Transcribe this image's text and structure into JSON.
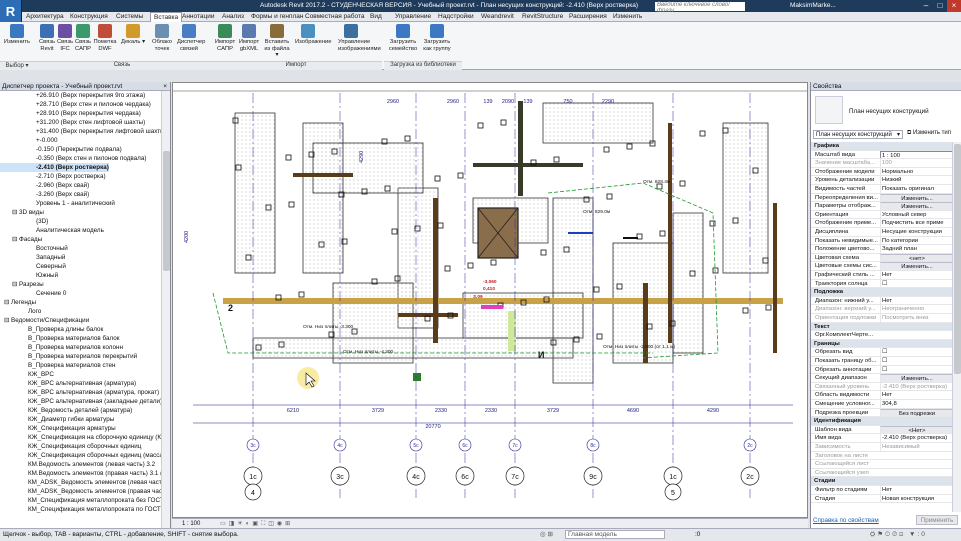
{
  "app": {
    "title": "Autodesk Revit 2017.2 - СТУДЕНЧЕСКАЯ ВЕРСИЯ -   Учебный проект.rvt - План несущих конструкций: -2.410 (Верх ростверка)",
    "logo": "R",
    "search_placeholder": "Введите ключевое слово/фразу",
    "user": "MaksimMarke..."
  },
  "tabs": [
    "Архитектура",
    "Конструкция",
    "Системы",
    "Вставка",
    "Аннотации",
    "Анализ",
    "Формы и генплан",
    "Совместная работа",
    "Вид",
    "Управление",
    "Надстройки",
    "Weandrevit",
    "RevitStructure",
    "Расширения",
    "Изменить"
  ],
  "active_tab": "Вставка",
  "ribbon": {
    "modify": "Изменить",
    "select": "Выбор ▾",
    "link_buttons": [
      "Связь Revit",
      "Связь IFC",
      "Связь САПР",
      "Пометка DWF",
      "Декаль ▾",
      "Облако точек",
      "Диспетчер связей"
    ],
    "link_group": "Связь",
    "import_buttons": [
      "Импорт САПР",
      "Импорт gbXML",
      "Вставить из файла ▾",
      "Изображение",
      "Управление изображениями"
    ],
    "import_group": "Импорт",
    "library_buttons": [
      "Загрузить семейство",
      "Загрузить как группу"
    ],
    "library_group": "Загрузка из библиотеки"
  },
  "project_browser": {
    "title": "Диспетчер проекта - Учебный проект.rvt",
    "items": [
      {
        "t": "+26.910 (Верх перекрытия 9го этажа)",
        "l": 4
      },
      {
        "t": "+28.710 (Верх стен и пилонов чердака)",
        "l": 4
      },
      {
        "t": "+28.910 (Верх перекрытия чердака)",
        "l": 4
      },
      {
        "t": "+31.200 (Верх стен лифтовой шахты)",
        "l": 4
      },
      {
        "t": "+31.400 (Верх перекрытия лифтовой шахты)",
        "l": 4
      },
      {
        "t": "+-0.000",
        "l": 4
      },
      {
        "t": "-0.150 (Перекрытие подвала)",
        "l": 4
      },
      {
        "t": "-0.350 (Верх стен и пилонов подвала)",
        "l": 4
      },
      {
        "t": "-2.410 (Верх ростверка)",
        "l": 4,
        "sel": true,
        "b": true
      },
      {
        "t": "-2.710 (Верх ростверка)",
        "l": 4
      },
      {
        "t": "-2.960 (Верх свай)",
        "l": 4
      },
      {
        "t": "-3.260 (Верх свай)",
        "l": 4
      },
      {
        "t": "Уровень 1 - аналитический",
        "l": 4
      },
      {
        "t": "⊟ 3D виды",
        "l": 1
      },
      {
        "t": "{3D}",
        "l": 4
      },
      {
        "t": "Аналитическая модель",
        "l": 4
      },
      {
        "t": "⊟ Фасады",
        "l": 1
      },
      {
        "t": "Восточный",
        "l": 4
      },
      {
        "t": "Западный",
        "l": 4
      },
      {
        "t": "Северный",
        "l": 4
      },
      {
        "t": "Южный",
        "l": 4
      },
      {
        "t": "⊟ Разрезы",
        "l": 1
      },
      {
        "t": "Сечение 0",
        "l": 4
      },
      {
        "t": "⊟ Легенды",
        "l": 0
      },
      {
        "t": "Лого",
        "l": 3
      },
      {
        "t": "⊟ Ведомости/Спецификации",
        "l": 0
      },
      {
        "t": "В_Проверка длины балок",
        "l": 3
      },
      {
        "t": "В_Проверка материалов балок",
        "l": 3
      },
      {
        "t": "В_Проверка материалов колонн",
        "l": 3
      },
      {
        "t": "В_Проверка материалов перекрытий",
        "l": 3
      },
      {
        "t": "В_Проверка материалов стен",
        "l": 3
      },
      {
        "t": "КЖ_ВРС",
        "l": 3
      },
      {
        "t": "КЖ_ВРС альтернативная (арматура)",
        "l": 3
      },
      {
        "t": "КЖ_ВРС альтернативная (арматура, прокат)",
        "l": 3
      },
      {
        "t": "КЖ_ВРС альтернативная (закладные детали)",
        "l": 3
      },
      {
        "t": "КЖ_Ведомость деталей (арматура)",
        "l": 3
      },
      {
        "t": "КЖ_Диаметр гибки арматуры",
        "l": 3
      },
      {
        "t": "КЖ_Спецификация арматуры",
        "l": 3
      },
      {
        "t": "КЖ_Спецификация на сборочную единицу (КЖИ",
        "l": 3
      },
      {
        "t": "КЖ_Спецификация сборочных единиц",
        "l": 3
      },
      {
        "t": "КЖ_Спецификация сборочных единиц (масса ед",
        "l": 3
      },
      {
        "t": "КМ.Ведомость элементов (левая часть) 3.2",
        "l": 3
      },
      {
        "t": "КМ.Ведомость элементов (правая часть) 3.1 (пра",
        "l": 3
      },
      {
        "t": "КМ_ADSK_Ведомость элементов (левая часть)",
        "l": 3
      },
      {
        "t": "КМ_ADSK_Ведомость элементов (правая часть)",
        "l": 3
      },
      {
        "t": "КМ_Спецификация металлопроката без ГОСТ",
        "l": 3
      },
      {
        "t": "КМ_Спецификация металлопроката по ГОСТ",
        "l": 3
      }
    ]
  },
  "drawing": {
    "dims_bottom": [
      "6210",
      "3729",
      "2330",
      "2330",
      "3729",
      "4690",
      "4290"
    ],
    "total": "20770",
    "dims_top": [
      "2960",
      "2960",
      "139",
      "2090",
      "139",
      "750",
      "2290"
    ],
    "grid_bubbles_top": [
      "3с",
      "4с",
      "5с",
      "6с",
      "7с",
      "8с",
      "2с"
    ],
    "grid_bubbles_bottom": [
      "1с",
      "3с",
      "4с",
      "6с",
      "7с",
      "9с",
      "1с",
      "2с"
    ],
    "axis_numbers": [
      "4",
      "5"
    ],
    "side_dims": [
      "4200",
      "4290"
    ],
    "level_labels": [
      "Отм. Низ плиты -4.300",
      "Отм. Низ плиты -3.300",
      "Отм. Низ плиты -2.900 (от 1.1 м)",
      "Отм. 828.4м",
      "Отм. 829.0м"
    ],
    "marks": [
      "2",
      "И",
      "З.09",
      "-3,060",
      "0,410"
    ],
    "scale": "1 : 100"
  },
  "properties": {
    "title": "Свойства",
    "type_name": "План несущих конструкций",
    "type_selector": "План несущих конструкций",
    "edit_type": "Изменить тип",
    "rows": [
      {
        "sec": "Графика"
      },
      {
        "k": "Масштаб вида",
        "v": "1 : 100",
        "input": true
      },
      {
        "k": "Значение масштаба...",
        "v": "100",
        "dim": true
      },
      {
        "k": "Отображение модели",
        "v": "Нормально"
      },
      {
        "k": "Уровень детализации",
        "v": "Низкий"
      },
      {
        "k": "Видимость частей",
        "v": "Показать оригинал"
      },
      {
        "k": "Переопределения ви...",
        "v": "Изменить...",
        "btn": true
      },
      {
        "k": "Параметры отображ...",
        "v": "Изменить...",
        "btn": true
      },
      {
        "k": "Ориентация",
        "v": "Условный север"
      },
      {
        "k": "Отображение приме...",
        "v": "Подчистить все приме"
      },
      {
        "k": "Дисциплина",
        "v": "Несущие конструкции"
      },
      {
        "k": "Показать невидимые...",
        "v": "По категории"
      },
      {
        "k": "Положение цветово...",
        "v": "Задний план"
      },
      {
        "k": "Цветовая схема",
        "v": "<нет>",
        "btn": true
      },
      {
        "k": "Цветовые схемы сис...",
        "v": "Изменить...",
        "btn": true
      },
      {
        "k": "Графический стиль ...",
        "v": "Нет"
      },
      {
        "k": "Траектория солнца",
        "v": "☐"
      },
      {
        "sec": "Подложка"
      },
      {
        "k": "Диапазон: нижний у...",
        "v": "Нет"
      },
      {
        "k": "Диапазон: верхний у...",
        "v": "Неограниченно",
        "dim": true
      },
      {
        "k": "Ориентация подложки",
        "v": "Посмотреть вниз",
        "dim": true
      },
      {
        "sec": "Текст"
      },
      {
        "k": "Орг.КомплектЧерте...",
        "v": ""
      },
      {
        "sec": "Границы"
      },
      {
        "k": "Обрезать вид",
        "v": "☐"
      },
      {
        "k": "Показать границу об...",
        "v": "☐"
      },
      {
        "k": "Обрезать аннотации",
        "v": "☐"
      },
      {
        "k": "Секущий диапазон",
        "v": "Изменить...",
        "btn": true
      },
      {
        "k": "Связанный уровень",
        "v": "-2.410 (Верх ростверка)",
        "dim": true
      },
      {
        "k": "Область видимости",
        "v": "Нет"
      },
      {
        "k": "Смещение условног...",
        "v": "304,8"
      },
      {
        "k": "Подрезка проекции",
        "v": "Без подрезки",
        "btn": true
      },
      {
        "sec": "Идентификация"
      },
      {
        "k": "Шаблон вида",
        "v": "<Нет>",
        "btn": true
      },
      {
        "k": "Имя вида",
        "v": "-2.410 (Верх ростверка)"
      },
      {
        "k": "Зависимость",
        "v": "Независимый",
        "dim": true
      },
      {
        "k": "Заголовок на листе",
        "v": "",
        "dim": true
      },
      {
        "k": "Ссылающийся лист",
        "v": "",
        "dim": true
      },
      {
        "k": "Ссылающийся узел",
        "v": "",
        "dim": true
      },
      {
        "sec": "Стадии"
      },
      {
        "k": "Фильтр по стадиям",
        "v": "Нет"
      },
      {
        "k": "Стадия",
        "v": "Новая конструкция"
      }
    ],
    "help_link": "Справка по свойствам",
    "apply": "Применить"
  },
  "status": {
    "message": "Щелчок - выбор, TAB - варианты, CTRL - добавление, SHIFT - снятие выбора.",
    "model": "Главная модель",
    "zero": ":0"
  }
}
